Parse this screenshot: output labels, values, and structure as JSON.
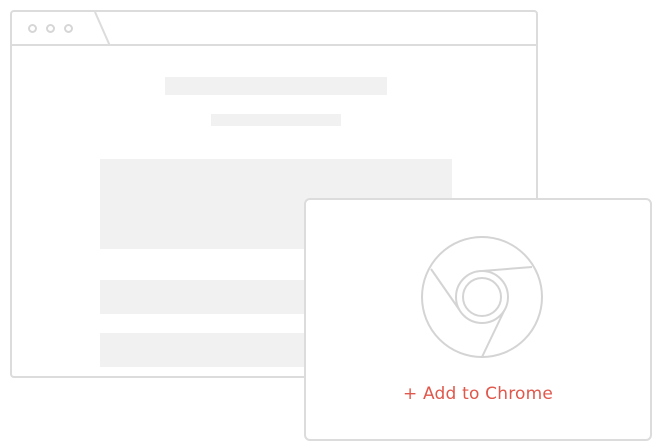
{
  "extension_card": {
    "add_button_label": "+ Add to Chrome",
    "icon": "chrome-logo-icon"
  },
  "colors": {
    "accent": "#e0574b",
    "border": "#dcdcdc",
    "placeholder": "#f1f1f1"
  }
}
